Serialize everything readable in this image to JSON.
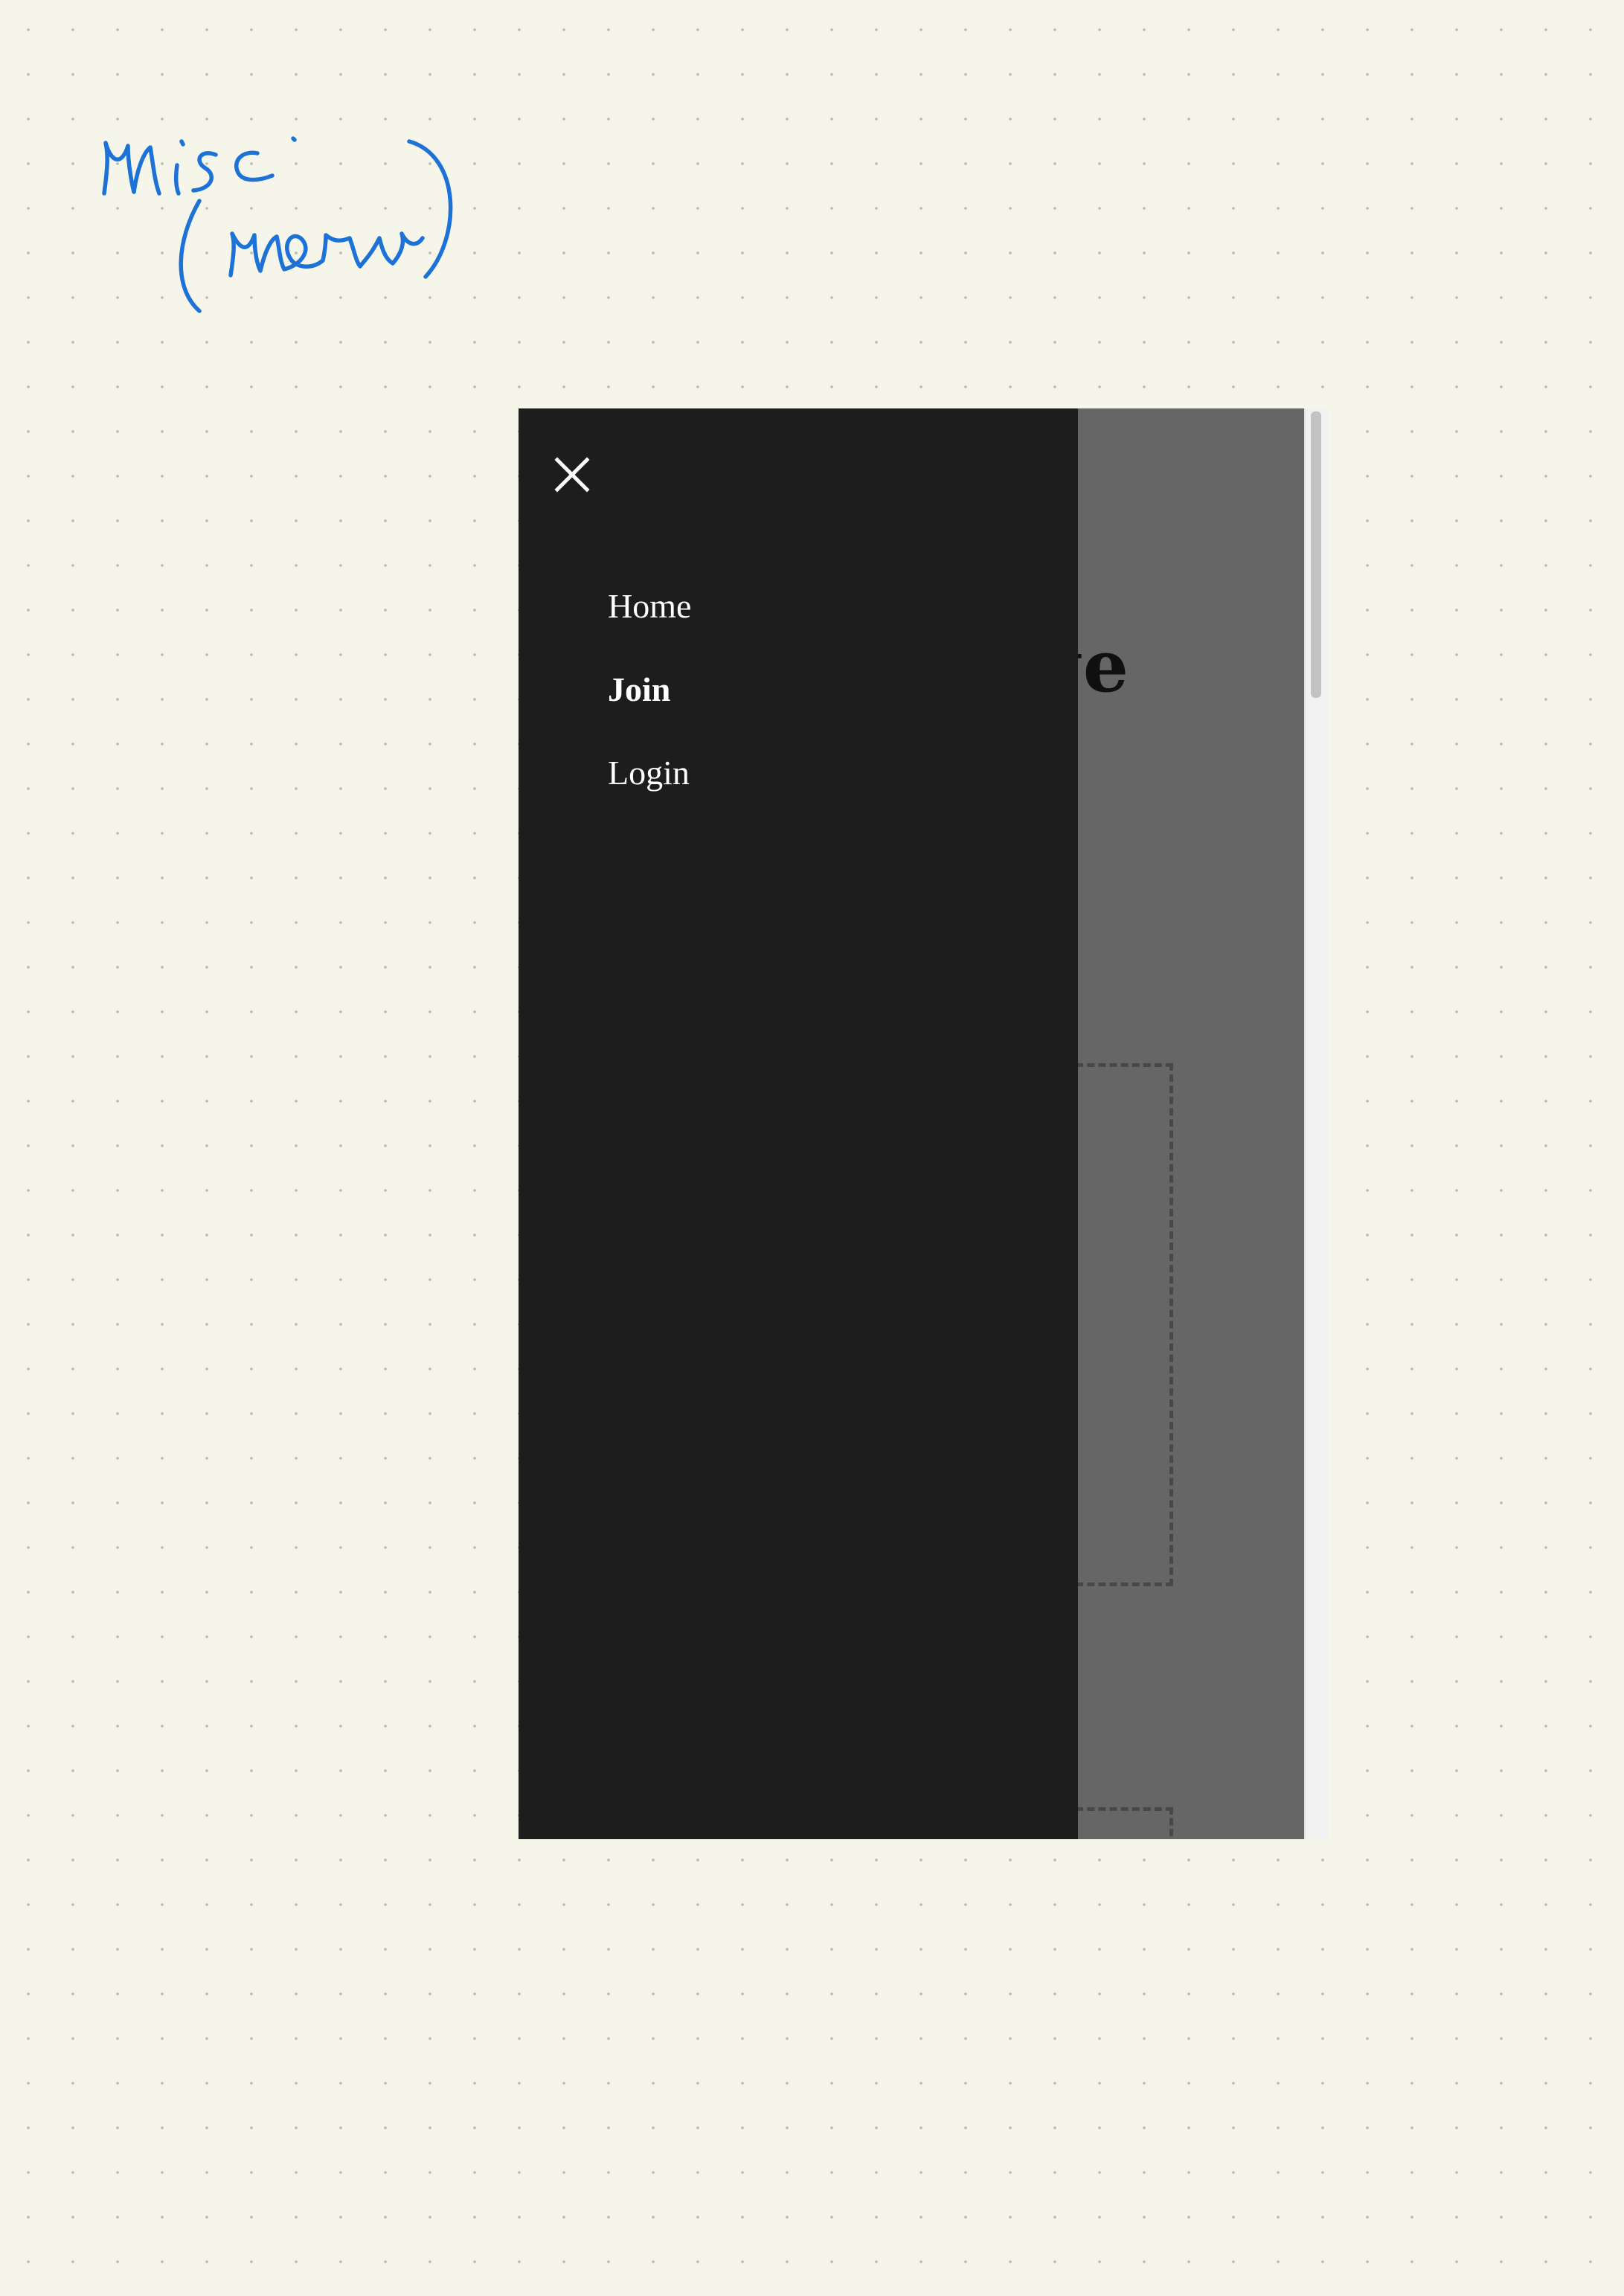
{
  "handwritten_note": {
    "text": "misc (menu)",
    "color": "#1d72d8"
  },
  "page": {
    "heading_fragment": "ge"
  },
  "drawer": {
    "close_icon": "close-icon",
    "items": [
      {
        "label": "Home",
        "bold": false
      },
      {
        "label": "Join",
        "bold": true
      },
      {
        "label": "Login",
        "bold": false
      }
    ]
  },
  "colors": {
    "canvas": "#f6f5ea",
    "drawer_background": "#1d1d1d",
    "overlay": "rgba(0,0,0,0.6)",
    "menu_text": "#ffffff"
  }
}
